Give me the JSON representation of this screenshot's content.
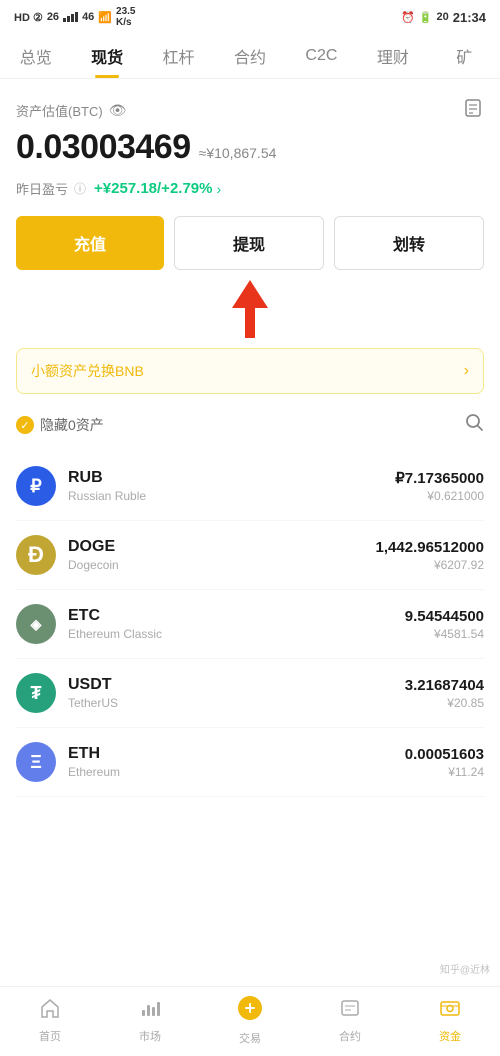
{
  "statusBar": {
    "left": {
      "network": "HD ②",
      "signal4g": "46",
      "wifi": "26",
      "speed": "23.5 K/s"
    },
    "right": {
      "alarm": "⏰",
      "battery": "20",
      "time": "21:34"
    }
  },
  "navTabs": {
    "items": [
      {
        "label": "总览",
        "active": false
      },
      {
        "label": "现货",
        "active": true
      },
      {
        "label": "杠杆",
        "active": false
      },
      {
        "label": "合约",
        "active": false
      },
      {
        "label": "C2C",
        "active": false
      },
      {
        "label": "理财",
        "active": false
      },
      {
        "label": "矿",
        "active": false
      }
    ]
  },
  "assetSection": {
    "label": "资产估值(BTC)",
    "btcValue": "0.03003469",
    "cnyApprox": "≈¥10,867.54",
    "pnlLabel": "昨日盈亏",
    "pnlValue": "+¥257.18/+2.79%"
  },
  "actionButtons": {
    "deposit": "充值",
    "withdraw": "提现",
    "transfer": "划转"
  },
  "exchangeBanner": {
    "text": "小额资产兑换BNB",
    "arrow": "›"
  },
  "filterRow": {
    "label": "隐藏0资产"
  },
  "assetList": [
    {
      "symbol": "RUB",
      "name": "Russian Ruble",
      "amount": "₽7.17365000",
      "cny": "¥0.621000",
      "iconClass": "asset-icon-rub",
      "iconText": "₽"
    },
    {
      "symbol": "DOGE",
      "name": "Dogecoin",
      "amount": "1,442.96512000",
      "cny": "¥6207.92",
      "iconClass": "asset-icon-doge",
      "iconText": "Ð"
    },
    {
      "symbol": "ETC",
      "name": "Ethereum Classic",
      "amount": "9.54544500",
      "cny": "¥4581.54",
      "iconClass": "asset-icon-etc",
      "iconText": "◈"
    },
    {
      "symbol": "USDT",
      "name": "TetherUS",
      "amount": "3.21687404",
      "cny": "¥20.85",
      "iconClass": "asset-icon-usdt",
      "iconText": "₮"
    },
    {
      "symbol": "ETH",
      "name": "Ethereum",
      "amount": "0.00051603",
      "cny": "¥11.24",
      "iconClass": "asset-icon-eth",
      "iconText": "Ξ"
    }
  ],
  "bottomNav": {
    "items": [
      {
        "label": "首页",
        "icon": "⌂",
        "active": false
      },
      {
        "label": "市场",
        "icon": "📊",
        "active": false
      },
      {
        "label": "交易",
        "icon": "🔄",
        "active": false
      },
      {
        "label": "合约",
        "icon": "📋",
        "active": false
      },
      {
        "label": "资金",
        "icon": "💰",
        "active": true
      }
    ]
  },
  "watermark": "知乎@近林"
}
